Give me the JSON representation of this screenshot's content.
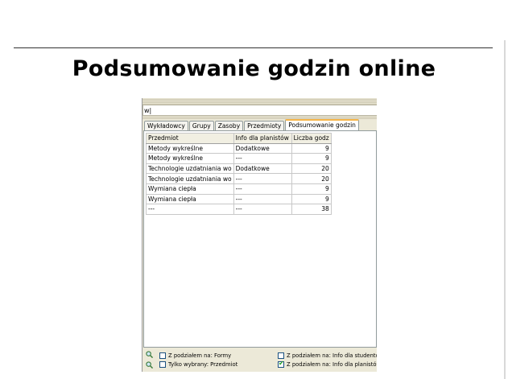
{
  "title": "Podsumowanie godzin online",
  "filter": {
    "value": "w|"
  },
  "tabs": [
    {
      "label": "Wykładowcy",
      "active": false
    },
    {
      "label": "Grupy",
      "active": false
    },
    {
      "label": "Zasoby",
      "active": false
    },
    {
      "label": "Przedmioty",
      "active": false
    },
    {
      "label": "Podsumowanie godzin",
      "active": true
    }
  ],
  "table": {
    "headers": [
      "Przedmiot",
      "Info dla planistów",
      "Liczba godz"
    ],
    "rows": [
      [
        "Metody wykreślne",
        "Dodatkowe",
        "9"
      ],
      [
        "Metody wykreślne",
        "---",
        "9"
      ],
      [
        "Technologie uzdatniania wo",
        "Dodatkowe",
        "20"
      ],
      [
        "Technologie uzdatniania wo",
        "---",
        "20"
      ],
      [
        "Wymiana ciepła",
        "---",
        "9"
      ],
      [
        "Wymiana ciepła",
        "---",
        "9"
      ],
      [
        "---",
        "---",
        "38"
      ]
    ]
  },
  "options": {
    "forms": {
      "label": "Z podziałem na: Formy",
      "checked": false
    },
    "selected": {
      "label": "Tylko wybrany: Przedmiot",
      "checked": false
    },
    "student_info": {
      "label": "Z podziałem na: Info dla studentów",
      "checked": false
    },
    "planner_info": {
      "label": "Z podziałem na: Info dla planistów",
      "checked": true
    }
  },
  "icons": {
    "zoom": "magnifier-icon",
    "check": "check-mark-icon"
  }
}
